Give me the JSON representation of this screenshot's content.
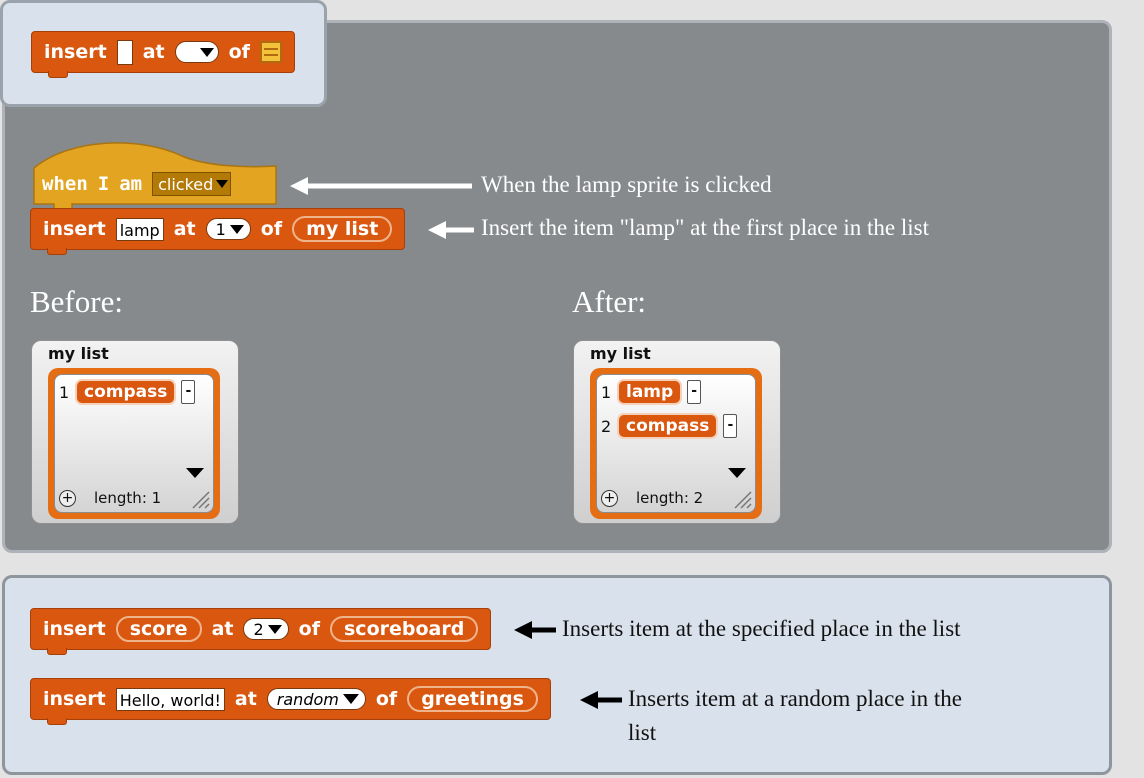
{
  "header_block": {
    "insert": "insert",
    "at": "at",
    "of": "of"
  },
  "hat_block": {
    "when": "when",
    "i": "I",
    "am": "am",
    "event": "clicked"
  },
  "main_block": {
    "insert": "insert",
    "item": "lamp",
    "at": "at",
    "index": "1",
    "of": "of",
    "list": "my list"
  },
  "notes": {
    "hat": "When the lamp sprite is clicked",
    "main": "Insert the item \"lamp\" at the first place in the list",
    "example1": "Inserts item at the specified place in the list",
    "example2_line1": "Inserts item at a random place in the",
    "example2_line2": "list"
  },
  "labels": {
    "before": "Before:",
    "after": "After:"
  },
  "before_watcher": {
    "title": "my list",
    "items": [
      {
        "index": "1",
        "value": "compass"
      }
    ],
    "length_label": "length: 1"
  },
  "after_watcher": {
    "title": "my list",
    "items": [
      {
        "index": "1",
        "value": "lamp"
      },
      {
        "index": "2",
        "value": "compass"
      }
    ],
    "length_label": "length: 2"
  },
  "example1_block": {
    "insert": "insert",
    "item": "score",
    "at": "at",
    "index": "2",
    "of": "of",
    "list": "scoreboard"
  },
  "example2_block": {
    "insert": "insert",
    "item": "Hello, world!",
    "at": "at",
    "index": "random",
    "of": "of",
    "list": "greetings"
  },
  "minus_symbol": "-",
  "plus_symbol": "+",
  "colors": {
    "block_orange": "#d9570f",
    "hat_gold": "#e3a422",
    "panel_gray": "#868a8d",
    "panel_light": "#d9e2ec",
    "watcher_frame": "#e56d14"
  }
}
